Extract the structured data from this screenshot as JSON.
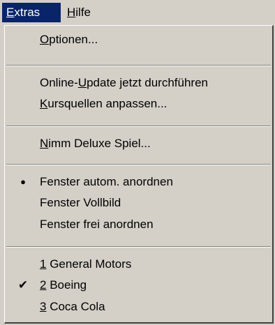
{
  "menubar": {
    "extras": {
      "accel": "E",
      "rest": "xtras"
    },
    "hilfe": {
      "accel": "H",
      "rest": "ilfe"
    }
  },
  "menu": {
    "optionen": {
      "pre": "",
      "accel": "O",
      "post": "ptionen..."
    },
    "online_update": {
      "pre": "Online-",
      "accel": "U",
      "post": "pdate jetzt durchführen"
    },
    "kursquellen": {
      "pre": "",
      "accel": "K",
      "post": "ursquellen anpassen..."
    },
    "nimm_deluxe": {
      "pre": "",
      "accel": "N",
      "post": "imm Deluxe Spiel..."
    },
    "fenster_autom": {
      "label": "Fenster autom. anordnen",
      "mark": "●"
    },
    "fenster_vollbild": {
      "label": "Fenster Vollbild"
    },
    "fenster_frei": {
      "label": "Fenster frei anordnen"
    },
    "item1": {
      "accel": "1",
      "post": " General Motors"
    },
    "item2": {
      "accel": "2",
      "post": " Boeing",
      "mark": "✔"
    },
    "item3": {
      "accel": "3",
      "post": " Coca Cola"
    }
  },
  "colors": {
    "menu_face": "#d4d0c8",
    "highlight": "#0a246a",
    "highlight_text": "#ffffff"
  }
}
